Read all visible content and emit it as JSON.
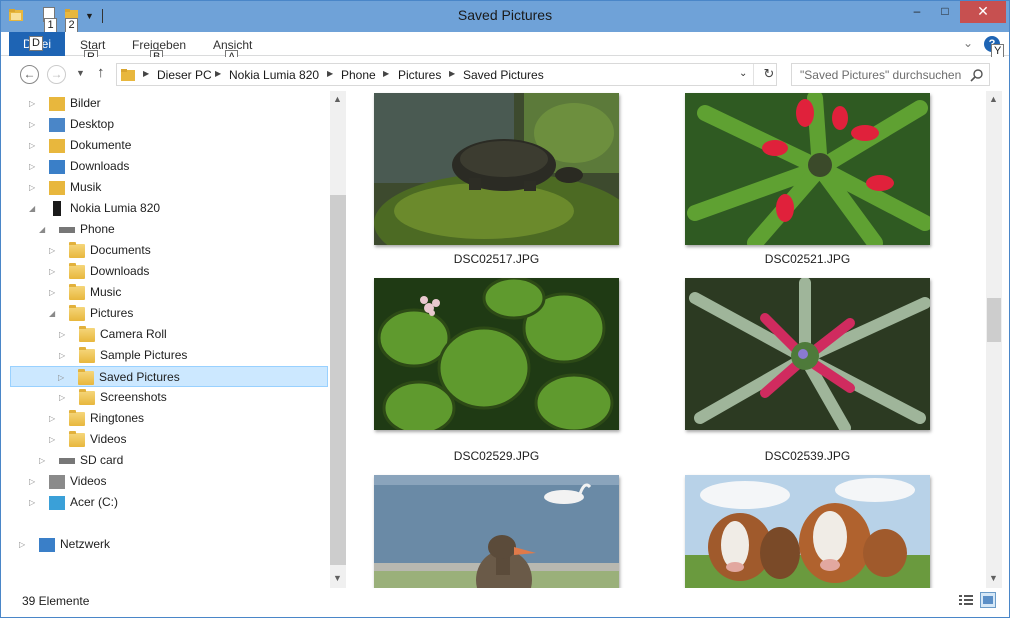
{
  "window": {
    "title": "Saved Pictures"
  },
  "quick_access": {
    "keytip_1": "1",
    "keytip_2": "2"
  },
  "window_controls": {
    "minimize": "–",
    "maximize": "□",
    "close": "✕"
  },
  "ribbon": {
    "tabs": [
      {
        "label": "Datei",
        "keytip": "D"
      },
      {
        "label": "Start",
        "keytip": "R"
      },
      {
        "label": "Freigeben",
        "keytip": "B"
      },
      {
        "label": "Ansicht",
        "keytip": "A"
      }
    ],
    "help_label": "?",
    "help_keytip": "Y"
  },
  "address_bar": {
    "breadcrumbs": [
      "Dieser PC",
      "Nokia Lumia 820",
      "Phone",
      "Pictures",
      "Saved Pictures"
    ]
  },
  "search": {
    "placeholder": "\"Saved Pictures\" durchsuchen"
  },
  "nav_tree": [
    {
      "label": "Bilder",
      "icon": "pictures-library-icon",
      "level": 1,
      "expandable": true
    },
    {
      "label": "Desktop",
      "icon": "desktop-folder-icon",
      "level": 1,
      "expandable": true
    },
    {
      "label": "Dokumente",
      "icon": "documents-library-icon",
      "level": 1,
      "expandable": true
    },
    {
      "label": "Downloads",
      "icon": "downloads-folder-icon",
      "level": 1,
      "expandable": true
    },
    {
      "label": "Musik",
      "icon": "music-library-icon",
      "level": 1,
      "expandable": true
    },
    {
      "label": "Nokia Lumia 820",
      "icon": "phone-device-icon",
      "level": 1,
      "expanded": true
    },
    {
      "label": "Phone",
      "icon": "drive-icon",
      "level": 2,
      "expanded": true
    },
    {
      "label": "Documents",
      "icon": "folder-icon",
      "level": 3,
      "expandable": true
    },
    {
      "label": "Downloads",
      "icon": "folder-icon",
      "level": 3,
      "expandable": true
    },
    {
      "label": "Music",
      "icon": "folder-icon",
      "level": 3,
      "expandable": true
    },
    {
      "label": "Pictures",
      "icon": "folder-icon",
      "level": 3,
      "expanded": true
    },
    {
      "label": "Camera Roll",
      "icon": "folder-icon",
      "level": 4,
      "expandable": true
    },
    {
      "label": "Sample Pictures",
      "icon": "folder-icon",
      "level": 4,
      "expandable": true
    },
    {
      "label": "Saved Pictures",
      "icon": "folder-icon",
      "level": 4,
      "expandable": true,
      "selected": true
    },
    {
      "label": "Screenshots",
      "icon": "folder-icon",
      "level": 4,
      "expandable": true
    },
    {
      "label": "Ringtones",
      "icon": "folder-icon",
      "level": 3,
      "expandable": true
    },
    {
      "label": "Videos",
      "icon": "folder-icon",
      "level": 3,
      "expandable": true
    },
    {
      "label": "SD card",
      "icon": "drive-icon",
      "level": 2,
      "expandable": true
    },
    {
      "label": "Videos",
      "icon": "videos-library-icon",
      "level": 1,
      "expandable": true
    },
    {
      "label": "Acer (C:)",
      "icon": "windows-drive-icon",
      "level": 1,
      "expandable": true
    },
    {
      "label": "Netzwerk",
      "icon": "network-icon",
      "level": 0,
      "expandable": true
    }
  ],
  "files": [
    {
      "name": "DSC02517.JPG",
      "subject": "turtle-photo"
    },
    {
      "name": "DSC02521.JPG",
      "subject": "bromeliad-photo"
    },
    {
      "name": "DSC02529.JPG",
      "subject": "pilea-leaves-photo"
    },
    {
      "name": "DSC02539.JPG",
      "subject": "pink-bromeliad-photo"
    },
    {
      "name": "",
      "subject": "goose-swan-photo"
    },
    {
      "name": "",
      "subject": "cows-photo"
    }
  ],
  "status": {
    "count": "39 Elemente"
  },
  "colors": {
    "accent": "#1e64b4",
    "selection": "#cce8ff",
    "titlebar": "#6fa2d8",
    "close": "#c75050"
  }
}
